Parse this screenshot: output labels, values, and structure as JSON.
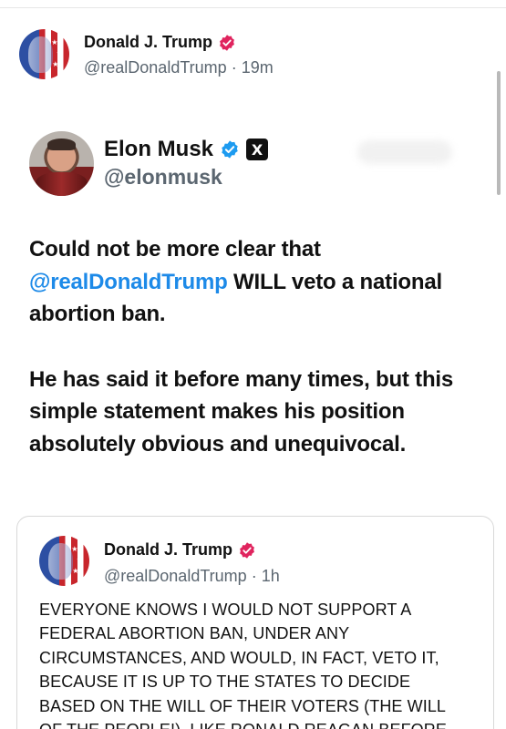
{
  "post": {
    "author_name": "Donald J. Trump",
    "author_handle": "@realDonaldTrump",
    "separator": "·",
    "time": "19m",
    "avatar_icon": "flag-portrait-avatar",
    "verified_color": "#e0245e"
  },
  "embedded": {
    "name": "Elon Musk",
    "handle": "@elonmusk",
    "verified_color": "#1d9bf0",
    "affiliation_badge": "X",
    "text_before_mention": "Could not be more clear that",
    "mention": "@realDonaldTrump",
    "text_after_mention": " WILL veto a national abortion ban.",
    "paragraph2": "He has said it before many times, but this simple statement makes his position absolutely obvious and unequivocal.",
    "mention_color": "#1d8ae8"
  },
  "quote": {
    "author_name": "Donald J. Trump",
    "author_handle": "@realDonaldTrump",
    "separator": "·",
    "time": "1h",
    "lines": [
      "EVERYONE KNOWS I WOULD NOT SUPPORT A",
      "FEDERAL ABORTION BAN, UNDER ANY",
      "CIRCUMSTANCES, AND WOULD, IN FACT, VETO IT,",
      "BECAUSE IT IS UP TO THE STATES TO DECIDE",
      "BASED ON THE WILL OF THEIR VOTERS (THE WILL",
      "OF THE PEOPLE!). LIKE RONALD REAGAN BEFORE"
    ]
  }
}
